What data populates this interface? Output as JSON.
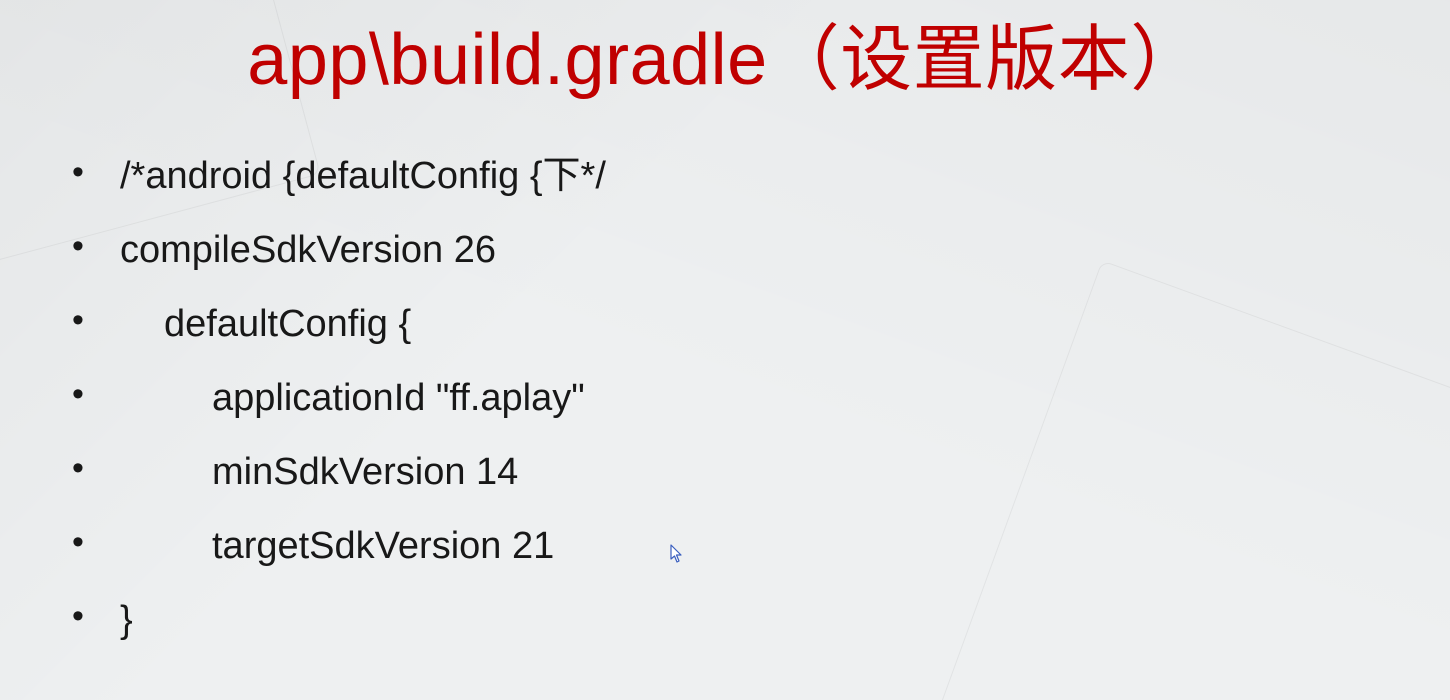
{
  "title": "app\\build.gradle（设置版本）",
  "bullets": {
    "b0": "/*android {defaultConfig {下*/",
    "b1": "compileSdkVersion 26",
    "b2": "defaultConfig {",
    "b3": "applicationId \"ff.aplay\"",
    "b4": "minSdkVersion 14",
    "b5": "targetSdkVersion 21",
    "b6": "}"
  }
}
